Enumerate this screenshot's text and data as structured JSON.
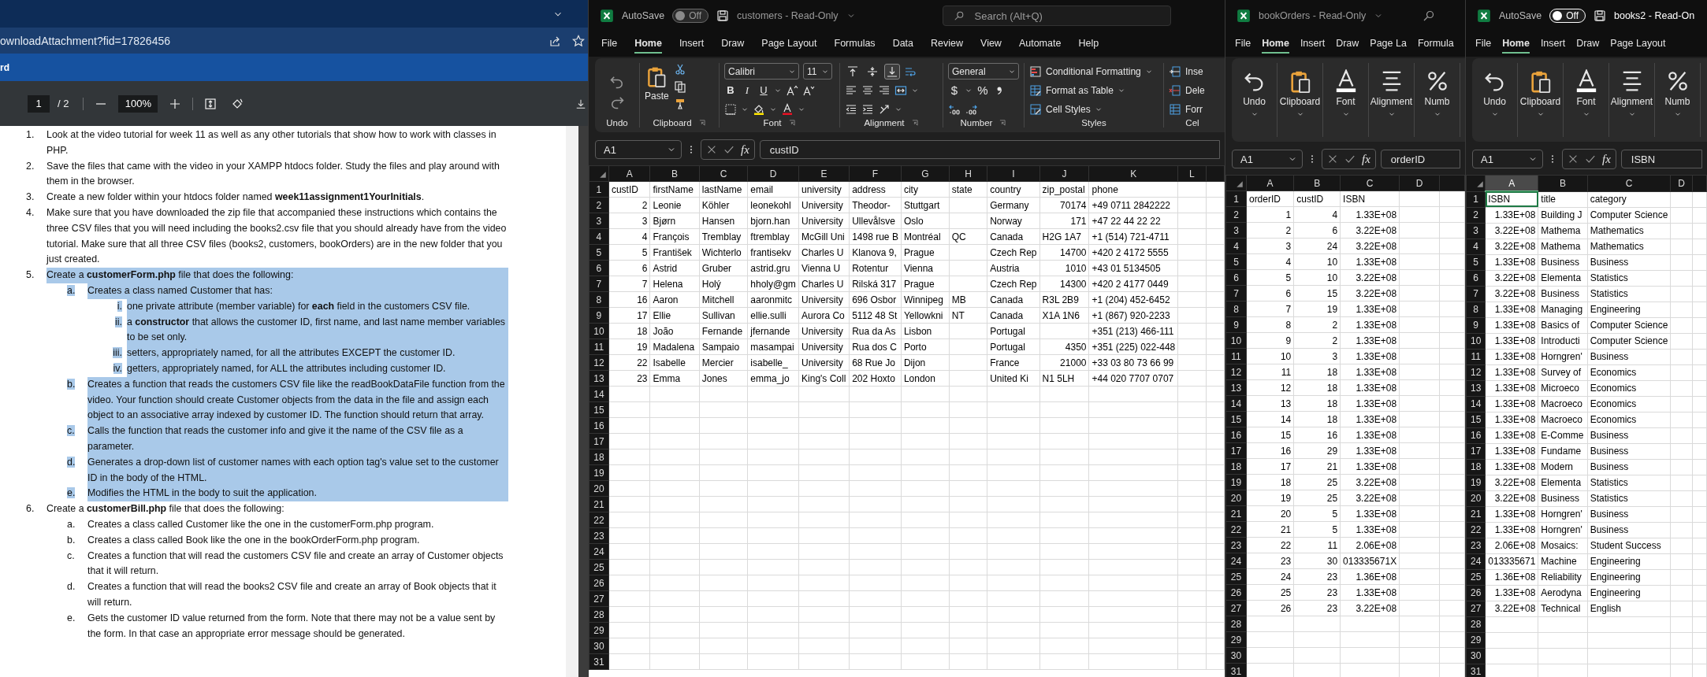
{
  "pdf": {
    "url": "ownloadAttachment?fid=17826456",
    "tab": "rd",
    "page": "1",
    "page_count": "/ 2",
    "zoom": "100%"
  },
  "doc": {
    "items": [
      {
        "marker": "1.",
        "text": "Look at the video tutorial for week 11 as well as any other tutorials that show how to work with classes in PHP.",
        "highlighted": false
      },
      {
        "marker": "2.",
        "text": "Save the files that came with the video in your XAMPP htdocs folder. Study the files and play around with them in the browser.",
        "highlighted": false
      },
      {
        "marker": "3.",
        "text": "Create a new folder within your htdocs folder named **week11assignment1YourInitials**.",
        "highlighted": false
      },
      {
        "marker": "4.",
        "text": "Make sure that you have downloaded the zip file that accompanied these instructions which contains the three CSV files that you will need including the books2.csv file that you should already have from the video tutorial. Make sure that all three CSV files (books2, customers, bookOrders) are in the new folder that you just created.",
        "highlighted": false
      },
      {
        "marker": "5.",
        "text": "Create a **customerForm.php** file that does the following:",
        "highlighted": true,
        "children": [
          {
            "marker": "a.",
            "text": "Creates a class named Customer that has:",
            "highlighted": true,
            "children": [
              {
                "marker": "i.",
                "text": "one private attribute (member variable) for **each** field in the customers CSV file.",
                "highlighted": true
              },
              {
                "marker": "ii.",
                "text": "a **constructor** that allows the customer ID, first name, and last name member variables to be set only.",
                "highlighted": true
              },
              {
                "marker": "iii.",
                "text": "setters, appropriately named, for all the attributes EXCEPT the customer ID.",
                "highlighted": true
              },
              {
                "marker": "iv.",
                "text": "getters, appropriately named, for ALL the attributes including customer ID.",
                "highlighted": true
              }
            ]
          },
          {
            "marker": "b.",
            "text": "Creates a function that reads the customers CSV file like the readBookDataFile function from the video. Your function should create Customer objects from the data in the file and assign each object to an associative array indexed by customer ID. The function should return that array.",
            "highlighted": true
          },
          {
            "marker": "c.",
            "text": "Calls the function that reads the customer info and give it the name of the CSV file as a parameter.",
            "highlighted": true
          },
          {
            "marker": "d.",
            "text": "Generates a drop-down list of customer names with each option tag's value set to the customer ID in the body of the HTML.",
            "highlighted": true
          },
          {
            "marker": "e.",
            "text": "Modifies the HTML in the body to suit the application.",
            "highlighted": true
          }
        ]
      },
      {
        "marker": "6.",
        "text": "Create a **customerBill.php** file that does the following:",
        "highlighted": false,
        "children": [
          {
            "marker": "a.",
            "text": "Creates a class called Customer like the one in the customerForm.php program.",
            "highlighted": false
          },
          {
            "marker": "b.",
            "text": "Creates a class called Book like the one in the bookOrderForm.php program.",
            "highlighted": false
          },
          {
            "marker": "c.",
            "text": "Creates a function that will read the customers CSV file and create an array of Customer objects that it will return.",
            "highlighted": false
          },
          {
            "marker": "d.",
            "text": "Creates a function that will read the books2 CSV file and create an array of Book objects that it will return.",
            "highlighted": false
          },
          {
            "marker": "e.",
            "text": "Gets the customer ID value returned from the form. Note that there may not be a value sent by the form. In that case an appropriate error message should be generated.",
            "highlighted": false
          }
        ]
      }
    ]
  },
  "workbooks": [
    {
      "active": false,
      "autosave": {
        "label": "AutoSave",
        "state": "Off",
        "on": false
      },
      "title": "customers  -  Read-Only",
      "title_menu": true,
      "search": {
        "placeholder": "Search (Alt+Q)"
      },
      "menu": [
        {
          "label": "File",
          "selected": false
        },
        {
          "label": "Home",
          "selected": true
        },
        {
          "label": "Insert",
          "selected": false
        },
        {
          "label": "Draw",
          "selected": false
        },
        {
          "label": "Page Layout",
          "selected": false
        },
        {
          "label": "Formulas",
          "selected": false
        },
        {
          "label": "Data",
          "selected": false
        },
        {
          "label": "Review",
          "selected": false
        },
        {
          "label": "View",
          "selected": false
        },
        {
          "label": "Automate",
          "selected": false
        },
        {
          "label": "Help",
          "selected": false
        }
      ],
      "ribbon": {
        "kind": "full",
        "undo": {
          "label": "Undo"
        },
        "clipboard": {
          "label": "Clipboard",
          "paste": "Paste"
        },
        "font": {
          "label": "Font",
          "name": "Calibri",
          "size": "11",
          "bold": "B",
          "italic": "I",
          "underline": "U"
        },
        "alignment": {
          "label": "Alignment",
          "vertical": [
            {
              "selected": false
            },
            {
              "selected": false
            },
            {
              "selected": true
            }
          ]
        },
        "number": {
          "label": "Number",
          "format": "General",
          "currency": "$",
          "percent": "%"
        },
        "styles": {
          "label": "Styles",
          "items": [
            "Conditional Formatting",
            "Format as Table",
            "Cell Styles"
          ]
        },
        "cells": {
          "label": "Cel",
          "items": [
            "Inse",
            "Dele",
            "Forr"
          ]
        }
      },
      "formula": {
        "cell": "A1",
        "fx": "fx",
        "value": "custID"
      },
      "sheet": {
        "columns": [
          {
            "letter": "A",
            "selected": false
          },
          {
            "letter": "B",
            "selected": false
          },
          {
            "letter": "C",
            "selected": false
          },
          {
            "letter": "D",
            "selected": false
          },
          {
            "letter": "E",
            "selected": false
          },
          {
            "letter": "F",
            "selected": false
          },
          {
            "letter": "G",
            "selected": false
          },
          {
            "letter": "H",
            "selected": false
          },
          {
            "letter": "I",
            "selected": false
          },
          {
            "letter": "J",
            "selected": false
          },
          {
            "letter": "K",
            "selected": false
          },
          {
            "letter": "L",
            "selected": false
          }
        ],
        "rows": [
          {
            "header": "1",
            "cells": [
              "custID",
              "firstName",
              "lastName",
              "email",
              "university",
              "address",
              "city",
              "state",
              "country",
              "zip_postal",
              "phone"
            ]
          },
          {
            "header": "2",
            "cells": [
              {
                "number": "2"
              },
              "Leonie",
              "Köhler",
              "leonekohl",
              "University",
              "Theodor-",
              "Stuttgart",
              null,
              "Germany",
              {
                "number": "70174"
              },
              "+49 0711 2842222"
            ]
          },
          {
            "header": "3",
            "cells": [
              {
                "number": "3"
              },
              "Bjørn",
              "Hansen",
              "bjorn.han",
              "University",
              "Ullevålsve",
              "Oslo",
              null,
              "Norway",
              {
                "number": "171"
              },
              "+47 22 44 22 22"
            ]
          },
          {
            "header": "4",
            "cells": [
              {
                "number": "4"
              },
              "François",
              "Tremblay",
              "ftremblay",
              "McGill Uni",
              "1498 rue B",
              "Montréal",
              "QC",
              "Canada",
              "H2G 1A7",
              "+1 (514) 721-4711"
            ]
          },
          {
            "header": "5",
            "cells": [
              {
                "number": "5"
              },
              "František",
              "Wichterlo",
              "frantisekv",
              "Charles U",
              "Klanova 9,",
              "Prague",
              null,
              "Czech Rep",
              {
                "number": "14700"
              },
              "+420 2 4172 5555"
            ]
          },
          {
            "header": "6",
            "cells": [
              {
                "number": "6"
              },
              "Astrid",
              "Gruber",
              "astrid.gru",
              "Vienna U",
              "Rotentur",
              "Vienna",
              null,
              "Austria",
              {
                "number": "1010"
              },
              "+43 01 5134505"
            ]
          },
          {
            "header": "7",
            "cells": [
              {
                "number": "7"
              },
              "Helena",
              "Holý",
              "hholy@gm",
              "Charles U",
              "Rilská 317",
              "Prague",
              null,
              "Czech Rep",
              {
                "number": "14300"
              },
              "+420 2 4177 0449"
            ]
          },
          {
            "header": "8",
            "cells": [
              {
                "number": "16"
              },
              "Aaron",
              "Mitchell",
              "aaronmitc",
              "University",
              "696 Osbor",
              "Winnipeg",
              "MB",
              "Canada",
              "R3L 2B9",
              "+1 (204) 452-6452"
            ]
          },
          {
            "header": "9",
            "cells": [
              {
                "number": "17"
              },
              "Ellie",
              "Sullivan",
              "ellie.sulli",
              "Aurora Co",
              "5112 48 St",
              "Yellowkni",
              "NT",
              "Canada",
              "X1A 1N6",
              "+1 (867) 920-2233"
            ]
          },
          {
            "header": "10",
            "cells": [
              {
                "number": "18"
              },
              "João",
              "Fernande",
              "jfernande",
              "University",
              "Rua da As",
              "Lisbon",
              null,
              "Portugal",
              null,
              "+351 (213) 466-111"
            ]
          },
          {
            "header": "11",
            "cells": [
              {
                "number": "19"
              },
              "Madalena",
              "Sampaio",
              "masampai",
              "University",
              "Rua dos C",
              "Porto",
              null,
              "Portugal",
              {
                "number": "4350"
              },
              "+351 (225) 022-448"
            ]
          },
          {
            "header": "12",
            "cells": [
              {
                "number": "22"
              },
              "Isabelle",
              "Mercier",
              "isabelle_",
              "University",
              "68  Rue Jo",
              "Dijon",
              null,
              "France",
              {
                "number": "21000"
              },
              "+33 03 80 73 66 99"
            ]
          },
          {
            "header": "13",
            "cells": [
              {
                "number": "23"
              },
              "Emma",
              "Jones",
              "emma_jo",
              "King's Coll",
              "202 Hoxto",
              "London",
              null,
              "United Ki",
              "N1 5LH",
              "+44 020 7707 0707"
            ]
          },
          {
            "header": "14"
          },
          {
            "header": "15"
          },
          {
            "header": "16"
          },
          {
            "header": "17"
          },
          {
            "header": "18"
          },
          {
            "header": "19"
          },
          {
            "header": "20"
          },
          {
            "header": "21"
          },
          {
            "header": "22"
          },
          {
            "header": "23"
          },
          {
            "header": "24"
          },
          {
            "header": "25"
          },
          {
            "header": "26"
          },
          {
            "header": "27"
          },
          {
            "header": "28"
          },
          {
            "header": "29"
          },
          {
            "header": "30"
          },
          {
            "header": "31"
          }
        ]
      }
    },
    {
      "active": false,
      "title": "bookOrders  -  Read-Only",
      "title_menu": true,
      "search_button": true,
      "menu": [
        {
          "label": "File",
          "selected": false
        },
        {
          "label": "Home",
          "selected": true
        },
        {
          "label": "Insert",
          "selected": false
        },
        {
          "label": "Draw",
          "selected": false
        },
        {
          "label": "Page La",
          "selected": false
        },
        {
          "label": "Formula",
          "selected": false
        }
      ],
      "ribbon": {
        "kind": "compact",
        "groups": [
          "Undo",
          "Clipboard",
          "Font",
          "Alignment",
          "Numb"
        ]
      },
      "formula": {
        "cell": "A1",
        "fx": "fx",
        "value": "orderID"
      },
      "sheet": {
        "columns": [
          {
            "letter": "A",
            "selected": false
          },
          {
            "letter": "B",
            "selected": false
          },
          {
            "letter": "C",
            "selected": false
          },
          {
            "letter": "D",
            "selected": false
          }
        ],
        "rows": [
          {
            "header": "1",
            "cells": [
              "orderID",
              "custID",
              "ISBN"
            ]
          },
          {
            "header": "2",
            "cells": [
              {
                "number": "1"
              },
              {
                "number": "4"
              },
              {
                "number": "1.33E+08"
              }
            ]
          },
          {
            "header": "3",
            "cells": [
              {
                "number": "2"
              },
              {
                "number": "6"
              },
              {
                "number": "3.22E+08"
              }
            ]
          },
          {
            "header": "4",
            "cells": [
              {
                "number": "3"
              },
              {
                "number": "24"
              },
              {
                "number": "3.22E+08"
              }
            ]
          },
          {
            "header": "5",
            "cells": [
              {
                "number": "4"
              },
              {
                "number": "10"
              },
              {
                "number": "1.33E+08"
              }
            ]
          },
          {
            "header": "6",
            "cells": [
              {
                "number": "5"
              },
              {
                "number": "10"
              },
              {
                "number": "3.22E+08"
              }
            ]
          },
          {
            "header": "7",
            "cells": [
              {
                "number": "6"
              },
              {
                "number": "15"
              },
              {
                "number": "3.22E+08"
              }
            ]
          },
          {
            "header": "8",
            "cells": [
              {
                "number": "7"
              },
              {
                "number": "19"
              },
              {
                "number": "1.33E+08"
              }
            ]
          },
          {
            "header": "9",
            "cells": [
              {
                "number": "8"
              },
              {
                "number": "2"
              },
              {
                "number": "1.33E+08"
              }
            ]
          },
          {
            "header": "10",
            "cells": [
              {
                "number": "9"
              },
              {
                "number": "2"
              },
              {
                "number": "1.33E+08"
              }
            ]
          },
          {
            "header": "11",
            "cells": [
              {
                "number": "10"
              },
              {
                "number": "3"
              },
              {
                "number": "1.33E+08"
              }
            ]
          },
          {
            "header": "12",
            "cells": [
              {
                "number": "11"
              },
              {
                "number": "18"
              },
              {
                "number": "1.33E+08"
              }
            ]
          },
          {
            "header": "13",
            "cells": [
              {
                "number": "12"
              },
              {
                "number": "18"
              },
              {
                "number": "1.33E+08"
              }
            ]
          },
          {
            "header": "14",
            "cells": [
              {
                "number": "13"
              },
              {
                "number": "18"
              },
              {
                "number": "1.33E+08"
              }
            ]
          },
          {
            "header": "15",
            "cells": [
              {
                "number": "14"
              },
              {
                "number": "18"
              },
              {
                "number": "1.33E+08"
              }
            ]
          },
          {
            "header": "16",
            "cells": [
              {
                "number": "15"
              },
              {
                "number": "16"
              },
              {
                "number": "1.33E+08"
              }
            ]
          },
          {
            "header": "17",
            "cells": [
              {
                "number": "16"
              },
              {
                "number": "29"
              },
              {
                "number": "1.33E+08"
              }
            ]
          },
          {
            "header": "18",
            "cells": [
              {
                "number": "17"
              },
              {
                "number": "21"
              },
              {
                "number": "1.33E+08"
              }
            ]
          },
          {
            "header": "19",
            "cells": [
              {
                "number": "18"
              },
              {
                "number": "25"
              },
              {
                "number": "3.22E+08"
              }
            ]
          },
          {
            "header": "20",
            "cells": [
              {
                "number": "19"
              },
              {
                "number": "25"
              },
              {
                "number": "3.22E+08"
              }
            ]
          },
          {
            "header": "21",
            "cells": [
              {
                "number": "20"
              },
              {
                "number": "5"
              },
              {
                "number": "1.33E+08"
              }
            ]
          },
          {
            "header": "22",
            "cells": [
              {
                "number": "21"
              },
              {
                "number": "5"
              },
              {
                "number": "1.33E+08"
              }
            ]
          },
          {
            "header": "23",
            "cells": [
              {
                "number": "22"
              },
              {
                "number": "11"
              },
              {
                "number": "2.06E+08"
              }
            ]
          },
          {
            "header": "24",
            "cells": [
              {
                "number": "23"
              },
              {
                "number": "30"
              },
              "013335671X"
            ]
          },
          {
            "header": "25",
            "cells": [
              {
                "number": "24"
              },
              {
                "number": "23"
              },
              {
                "number": "1.36E+08"
              }
            ]
          },
          {
            "header": "26",
            "cells": [
              {
                "number": "25"
              },
              {
                "number": "23"
              },
              {
                "number": "1.33E+08"
              }
            ]
          },
          {
            "header": "27",
            "cells": [
              {
                "number": "26"
              },
              {
                "number": "23"
              },
              {
                "number": "3.22E+08"
              }
            ]
          },
          {
            "header": "28"
          },
          {
            "header": "29"
          },
          {
            "header": "30"
          },
          {
            "header": "31"
          }
        ]
      }
    },
    {
      "active": true,
      "autosave": {
        "label": "AutoSave",
        "state": "Off",
        "on": false
      },
      "title": "books2 - Read-On",
      "menu": [
        {
          "label": "File",
          "selected": false
        },
        {
          "label": "Home",
          "selected": true
        },
        {
          "label": "Insert",
          "selected": false
        },
        {
          "label": "Draw",
          "selected": false
        },
        {
          "label": "Page Layout",
          "selected": false
        }
      ],
      "ribbon": {
        "kind": "compact",
        "groups": [
          "Undo",
          "Clipboard",
          "Font",
          "Alignment",
          "Numb"
        ]
      },
      "formula": {
        "cell": "A1",
        "fx": "fx",
        "value": "ISBN"
      },
      "sheet": {
        "columns": [
          {
            "letter": "A",
            "selected": true
          },
          {
            "letter": "B",
            "selected": false
          },
          {
            "letter": "C",
            "selected": false
          },
          {
            "letter": "D",
            "selected": false
          }
        ],
        "rows": [
          {
            "header": "1",
            "cells": [
              "ISBN",
              "title",
              "category"
            ]
          },
          {
            "header": "2",
            "cells": [
              {
                "number": "1.33E+08"
              },
              "Building J",
              "Computer Science"
            ]
          },
          {
            "header": "3",
            "cells": [
              {
                "number": "3.22E+08"
              },
              "Mathema",
              "Mathematics"
            ]
          },
          {
            "header": "4",
            "cells": [
              {
                "number": "3.22E+08"
              },
              "Mathema",
              "Mathematics"
            ]
          },
          {
            "header": "5",
            "cells": [
              {
                "number": "1.33E+08"
              },
              "Business",
              "Business"
            ]
          },
          {
            "header": "6",
            "cells": [
              {
                "number": "3.22E+08"
              },
              "Elementa",
              "Statistics"
            ]
          },
          {
            "header": "7",
            "cells": [
              {
                "number": "3.22E+08"
              },
              "Business",
              "Statistics"
            ]
          },
          {
            "header": "8",
            "cells": [
              {
                "number": "1.33E+08"
              },
              "Managing",
              "Engineering"
            ]
          },
          {
            "header": "9",
            "cells": [
              {
                "number": "1.33E+08"
              },
              "Basics of",
              "Computer Science"
            ]
          },
          {
            "header": "10",
            "cells": [
              {
                "number": "1.33E+08"
              },
              "Introducti",
              "Computer Science"
            ]
          },
          {
            "header": "11",
            "cells": [
              {
                "number": "1.33E+08"
              },
              "Horngren'",
              "Business"
            ]
          },
          {
            "header": "12",
            "cells": [
              {
                "number": "1.33E+08"
              },
              "Survey of",
              "Economics"
            ]
          },
          {
            "header": "13",
            "cells": [
              {
                "number": "1.33E+08"
              },
              "Microeco",
              "Economics"
            ]
          },
          {
            "header": "14",
            "cells": [
              {
                "number": "1.33E+08"
              },
              "Macroeco",
              "Economics"
            ]
          },
          {
            "header": "15",
            "cells": [
              {
                "number": "1.33E+08"
              },
              "Macroeco",
              "Economics"
            ]
          },
          {
            "header": "16",
            "cells": [
              {
                "number": "1.33E+08"
              },
              "E-Comme",
              "Business"
            ]
          },
          {
            "header": "17",
            "cells": [
              {
                "number": "1.33E+08"
              },
              "Fundame",
              "Business"
            ]
          },
          {
            "header": "18",
            "cells": [
              {
                "number": "1.33E+08"
              },
              "Modern",
              "Business"
            ]
          },
          {
            "header": "19",
            "cells": [
              {
                "number": "3.22E+08"
              },
              "Elementa",
              "Statistics"
            ]
          },
          {
            "header": "20",
            "cells": [
              {
                "number": "3.22E+08"
              },
              "Business",
              "Statistics"
            ]
          },
          {
            "header": "21",
            "cells": [
              {
                "number": "1.33E+08"
              },
              "Horngren'",
              "Business"
            ]
          },
          {
            "header": "22",
            "cells": [
              {
                "number": "1.33E+08"
              },
              "Horngren'",
              "Business"
            ]
          },
          {
            "header": "23",
            "cells": [
              {
                "number": "2.06E+08"
              },
              "Mosaics:",
              "Student Success"
            ]
          },
          {
            "header": "24",
            "cells": [
              "013335671",
              "Machine",
              "Engineering"
            ]
          },
          {
            "header": "25",
            "cells": [
              {
                "number": "1.36E+08"
              },
              "Reliability",
              "Engineering"
            ]
          },
          {
            "header": "26",
            "cells": [
              {
                "number": "1.33E+08"
              },
              "Aerodyna",
              "Engineering"
            ]
          },
          {
            "header": "27",
            "cells": [
              {
                "number": "3.22E+08"
              },
              "Technical",
              "English"
            ]
          },
          {
            "header": "28"
          },
          {
            "header": "29"
          },
          {
            "header": "30"
          },
          {
            "header": "31"
          }
        ]
      }
    }
  ]
}
